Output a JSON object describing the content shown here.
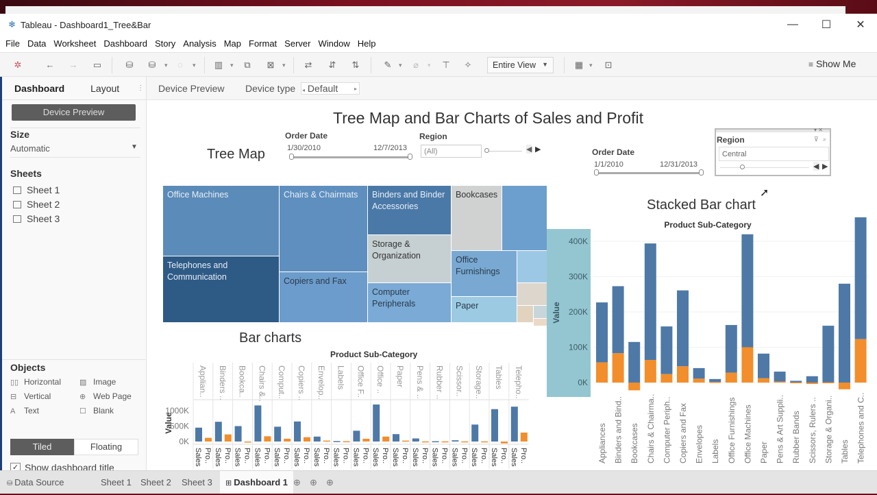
{
  "window": {
    "title": "Tableau - Dashboard1_Tree&Bar",
    "minimize": "—",
    "maximize": "☐",
    "close": "✕"
  },
  "menu": [
    "File",
    "Data",
    "Worksheet",
    "Dashboard",
    "Story",
    "Analysis",
    "Map",
    "Format",
    "Server",
    "Window",
    "Help"
  ],
  "toolbar": {
    "fit_value": "Entire View",
    "show_me": "Show Me",
    "icons": [
      "tableau-logo-icon",
      "undo-icon",
      "redo-icon",
      "save-icon",
      "new-datasource-icon",
      "pause-updates-icon",
      "refresh-icon",
      "new-worksheet-icon",
      "duplicate-icon",
      "clear-sheet-icon",
      "swap-icon",
      "sort-ascending-icon",
      "sort-descending-icon",
      "highlight-icon",
      "group-icon",
      "labels-icon",
      "pin-icon",
      "show-cards-icon",
      "presentation-icon"
    ]
  },
  "left_pane": {
    "tabs": [
      "Dashboard",
      "Layout"
    ],
    "device_preview_button": "Device Preview",
    "size_label": "Size",
    "size_value": "Automatic",
    "sheets_label": "Sheets",
    "sheets": [
      "Sheet 1",
      "Sheet 2",
      "Sheet 3"
    ],
    "objects_label": "Objects",
    "objects": [
      {
        "icon": "horizontal-icon",
        "glyph": "▯▯",
        "label": "Horizontal"
      },
      {
        "icon": "image-icon",
        "glyph": "▨",
        "label": "Image"
      },
      {
        "icon": "vertical-icon",
        "glyph": "⊟",
        "label": "Vertical"
      },
      {
        "icon": "web-page-icon",
        "glyph": "⊕",
        "label": "Web Page"
      },
      {
        "icon": "text-icon",
        "glyph": "A",
        "label": "Text"
      },
      {
        "icon": "blank-icon",
        "glyph": "☐",
        "label": "Blank"
      }
    ],
    "tiled": "Tiled",
    "floating": "Floating",
    "show_title_label": "Show dashboard title",
    "show_title_checked": true
  },
  "device_bar": {
    "device_preview": "Device Preview",
    "device_type_label": "Device type",
    "device_type_value": "Default"
  },
  "dashboard": {
    "title": "Tree Map and Bar Charts of Sales and Profit",
    "treemap_title": "Tree Map",
    "bar_title": "Bar charts",
    "stacked_title": "Stacked Bar chart",
    "filter1": {
      "label": "Order Date",
      "start": "1/30/2010",
      "end": "12/7/2013"
    },
    "filter2": {
      "label": "Region",
      "value": "(All)"
    },
    "filter3": {
      "label": "Order Date",
      "start": "1/1/2010",
      "end": "12/31/2013"
    },
    "filter4": {
      "label": "Region",
      "value": "Central"
    }
  },
  "treemap": {
    "cells": [
      {
        "label": "Office Machines",
        "color": "#5b8bb8",
        "text": "#e8eef5"
      },
      {
        "label": "Telephones and Communication",
        "color": "#2e5a86",
        "text": "#e8eef5"
      },
      {
        "label": "Chairs & Chairmats",
        "color": "#5e8fbf",
        "text": "#e8eef5"
      },
      {
        "label": "Copiers and Fax",
        "color": "#6c9ccb",
        "text": "#2a3a4a"
      },
      {
        "label": "Binders and Binder Accessories",
        "color": "#4a79a8",
        "text": "#e8eef5"
      },
      {
        "label": "Storage & Organization",
        "color": "#c6cfd2",
        "text": "#333"
      },
      {
        "label": "Computer Peripherals",
        "color": "#7aaad5",
        "text": "#2a3a4a"
      },
      {
        "label": "Bookcases",
        "color": "#cfd2d1",
        "text": "#333"
      },
      {
        "label": "",
        "color": "#6c9fcd",
        "text": "#333"
      },
      {
        "label": "Office Furnishings",
        "color": "#79a9d2",
        "text": "#2a3a4a"
      },
      {
        "label": "Paper",
        "color": "#9ccae3",
        "text": "#2a3a4a"
      },
      {
        "label": "",
        "color": "#9cc8e5",
        "text": "#333"
      },
      {
        "label": "",
        "color": "#ddd6cc",
        "text": "#333"
      },
      {
        "label": "",
        "color": "#e2d3bf",
        "text": "#333"
      },
      {
        "label": "",
        "color": "#c7d6db",
        "text": "#333"
      },
      {
        "label": "",
        "color": "#ebd9c8",
        "text": "#333"
      }
    ]
  },
  "chart_data": [
    {
      "type": "bar",
      "title": "Bar charts",
      "header": "Product Sub-Category",
      "ylabel": "Value",
      "yticks": [
        "1000K",
        "500K",
        "0K"
      ],
      "ylim": [
        -100000,
        1200000
      ],
      "categories": [
        "Applian..",
        "Binders ..",
        "Bookca..",
        "Chairs &..",
        "Comput..",
        "Copiers ..",
        "Envelop..",
        "Labels",
        "Office F..",
        "Office ..",
        "Paper",
        "Pens & ..",
        "Rubber ..",
        "Scissor..",
        "Storage..",
        "Tables",
        "Telepho.."
      ],
      "measure_labels": [
        "Sales",
        "Pro.."
      ],
      "series": [
        {
          "name": "Sales",
          "color": "#4e79a7",
          "values": [
            450000,
            640000,
            500000,
            1170000,
            480000,
            650000,
            160000,
            15000,
            350000,
            1200000,
            240000,
            100000,
            10000,
            40000,
            550000,
            1050000,
            1130000
          ]
        },
        {
          "name": "Profit",
          "color": "#f28e2b",
          "values": [
            120000,
            230000,
            -10000,
            170000,
            90000,
            140000,
            30000,
            10000,
            90000,
            160000,
            30000,
            5000,
            5000,
            5000,
            5000,
            -60000,
            290000
          ]
        }
      ]
    },
    {
      "type": "bar",
      "stacked": true,
      "title": "Stacked Bar chart",
      "header": "Product Sub-Category",
      "ylabel": "Value",
      "yticks": [
        "400K",
        "300K",
        "200K",
        "100K",
        "0K"
      ],
      "ylim": [
        -30000,
        480000
      ],
      "categories": [
        "Appliances",
        "Binders and Bind..",
        "Bookcases",
        "Chairs & Chairma..",
        "Computer Periph..",
        "Copiers and Fax",
        "Envelopes",
        "Labels",
        "Office Furnishings",
        "Office Machines",
        "Paper",
        "Pens & Art Suppli..",
        "Rubber Bands",
        "Scissors, Rulers ..",
        "Storage & Organi..",
        "Tables",
        "Telephones and C.."
      ],
      "series": [
        {
          "name": "Sales",
          "color": "#4e79a7",
          "values": [
            170000,
            190000,
            115000,
            330000,
            135000,
            215000,
            30000,
            8000,
            135000,
            320000,
            70000,
            28000,
            4000,
            18000,
            160000,
            280000,
            345000
          ]
        },
        {
          "name": "Profit",
          "color": "#f28e2b",
          "values": [
            57000,
            83000,
            -22000,
            64000,
            24000,
            46000,
            11000,
            2000,
            28000,
            100000,
            12000,
            3000,
            1000,
            -4000,
            1000,
            -19000,
            123000
          ]
        }
      ]
    }
  ],
  "bottom_tabs": {
    "data_source": "Data Source",
    "sheets": [
      "Sheet 1",
      "Sheet 2",
      "Sheet 3"
    ],
    "active": "Dashboard 1"
  }
}
